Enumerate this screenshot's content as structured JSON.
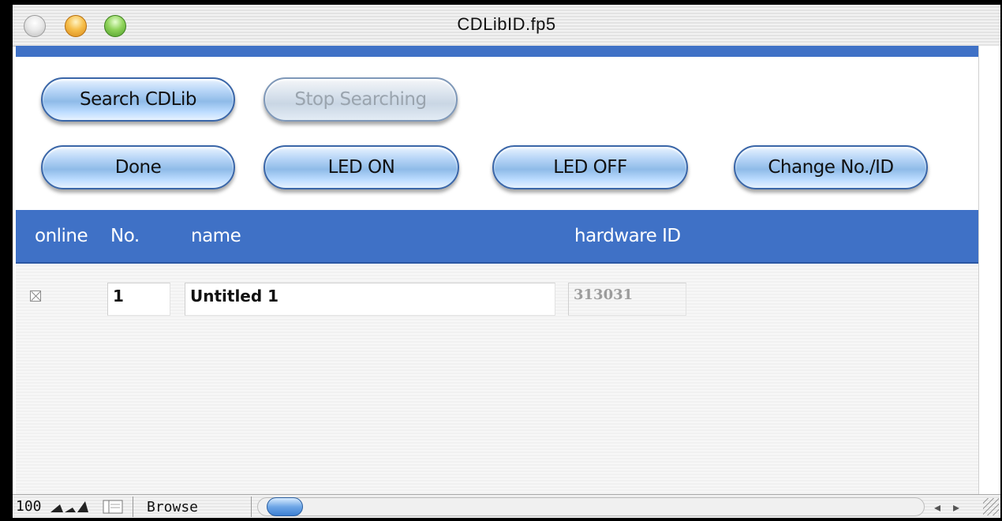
{
  "window": {
    "title": "CDLibID.fp5"
  },
  "buttons": {
    "search": "Search CDLib",
    "stop": "Stop Searching",
    "done": "Done",
    "led_on": "LED ON",
    "led_off": "LED OFF",
    "change": "Change No./ID"
  },
  "table": {
    "headers": {
      "online": "online",
      "no": "No.",
      "name": "name",
      "hardware_id": "hardware ID"
    },
    "rows": [
      {
        "online": false,
        "no": "1",
        "name": "Untitled 1",
        "hardware_id": "313031"
      }
    ]
  },
  "statusbar": {
    "zoom": "100",
    "mode": "Browse"
  },
  "colors": {
    "accent_blue": "#3f71c6"
  }
}
